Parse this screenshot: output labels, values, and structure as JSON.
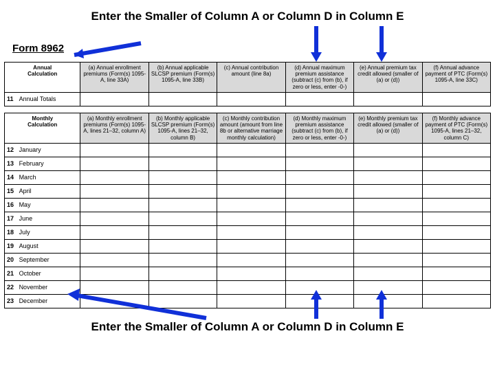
{
  "title_top": "Enter the Smaller of Column A or Column D in Column E",
  "form": "Form 8962",
  "annual": {
    "label": "Annual\nCalculation",
    "row_num": "11",
    "row_name": "Annual Totals",
    "cols": {
      "a": "(a) Annual enrollment premiums (Form(s) 1095-A, line 33A)",
      "b": "(b) Annual applicable SLCSP premium (Form(s) 1095-A, line 33B)",
      "c": "(c) Annual contribution amount (line 8a)",
      "d": "(d) Annual maximum premium assistance (subtract (c) from (b), if zero or less, enter -0-)",
      "e": "(e) Annual premium tax credit allowed (smaller of (a) or (d))",
      "f": "(f) Annual advance payment of PTC (Form(s) 1095-A, line 33C)"
    }
  },
  "monthly": {
    "label": "Monthly\nCalculation",
    "cols": {
      "a": "(a) Monthly enrollment premiums (Form(s) 1095-A, lines 21–32, column A)",
      "b": "(b) Monthly applicable SLCSP premium (Form(s) 1095-A, lines 21–32, column B)",
      "c": "(c) Monthly contribution amount (amount from line 8b or alternative marriage monthly calculation)",
      "d": "(d) Monthly maximum premium assistance (subtract (c) from (b), if zero or less, enter -0-)",
      "e": "(e) Monthly premium tax credit allowed (smaller of (a) or (d))",
      "f": "(f) Monthly advance payment of PTC (Form(s) 1095-A, lines 21–32, column C)"
    },
    "rows": [
      {
        "num": "12",
        "name": "January"
      },
      {
        "num": "13",
        "name": "February"
      },
      {
        "num": "14",
        "name": "March"
      },
      {
        "num": "15",
        "name": "April"
      },
      {
        "num": "16",
        "name": "May"
      },
      {
        "num": "17",
        "name": "June"
      },
      {
        "num": "18",
        "name": "July"
      },
      {
        "num": "19",
        "name": "August"
      },
      {
        "num": "20",
        "name": "September"
      },
      {
        "num": "21",
        "name": "October"
      },
      {
        "num": "22",
        "name": "November"
      },
      {
        "num": "23",
        "name": "December"
      }
    ]
  },
  "title_bottom": "Enter the Smaller of Column A or Column D in Column E"
}
